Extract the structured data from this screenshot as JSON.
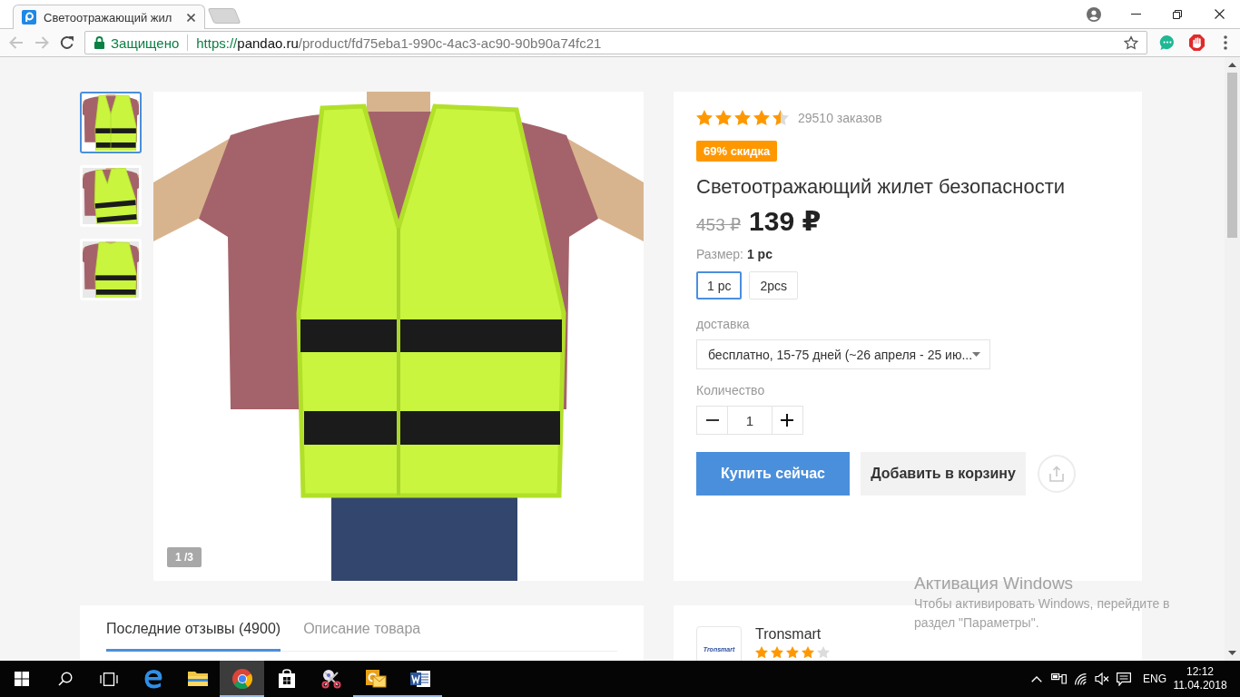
{
  "browser": {
    "tabs": [
      {
        "title": "Светоотражающий жил",
        "selected": true
      }
    ],
    "nav": [
      {
        "kind": "back",
        "disabled": true
      },
      {
        "kind": "forward",
        "disabled": true
      },
      {
        "kind": "reload",
        "disabled": false
      }
    ],
    "address": {
      "security": "Защищено",
      "url": {
        "scheme": "https://",
        "host": "pandao.ru",
        "path": "/product/fd75eba1-990c-4ac3-ac90-90b90a74fc21"
      }
    }
  },
  "gallery": {
    "thumbnails": [
      {
        "kind": "front",
        "selected": true
      },
      {
        "kind": "side",
        "selected": false
      },
      {
        "kind": "back",
        "selected": false
      }
    ],
    "counter": "1 /3"
  },
  "product": {
    "stars": 4.5,
    "orders": "29510 заказов",
    "discount": "69% скидка",
    "title": "Светоотражающий жилет безопасности",
    "old_price": "453 ₽",
    "price": "139 ₽",
    "size_label": "Размер: **1 pc**",
    "sizes": [
      {
        "label": "1 pc",
        "selected": true
      },
      {
        "label": "2pcs",
        "selected": false
      }
    ],
    "delivery_label": "доставка",
    "delivery": "бесплатно, 15-75 дней (~26 апреля - 25 ию...",
    "quantity_label": "Количество",
    "quantity": "1",
    "buy_button": "Купить сейчас",
    "cart_button": "Добавить в корзину"
  },
  "tabs": [
    {
      "label": "Последние отзывы (4900)",
      "selected": true
    },
    {
      "label": "Описание товара",
      "selected": false
    }
  ],
  "seller": {
    "logo_text": "Tronsmart",
    "name": "Tronsmart",
    "stars": 4
  },
  "activation_notice": {
    "title": "Активация Windows",
    "text": "Чтобы активировать Windows, перейдите в раздел \"Параметры\"."
  },
  "taskbar": {
    "apps": [
      {
        "kind": "swirl",
        "running": false,
        "active": false
      },
      {
        "kind": "folder",
        "running": false,
        "active": false
      },
      {
        "kind": "ring",
        "running": true,
        "active": true
      },
      {
        "kind": "bag",
        "running": false,
        "active": false
      },
      {
        "kind": "scissors",
        "running": false,
        "active": false
      },
      {
        "kind": "envelope",
        "running": true,
        "active": false
      },
      {
        "kind": "page",
        "running": true,
        "active": false
      }
    ],
    "muted": true,
    "language": "ENG",
    "time": "12:12",
    "date": "11.04.2018"
  }
}
